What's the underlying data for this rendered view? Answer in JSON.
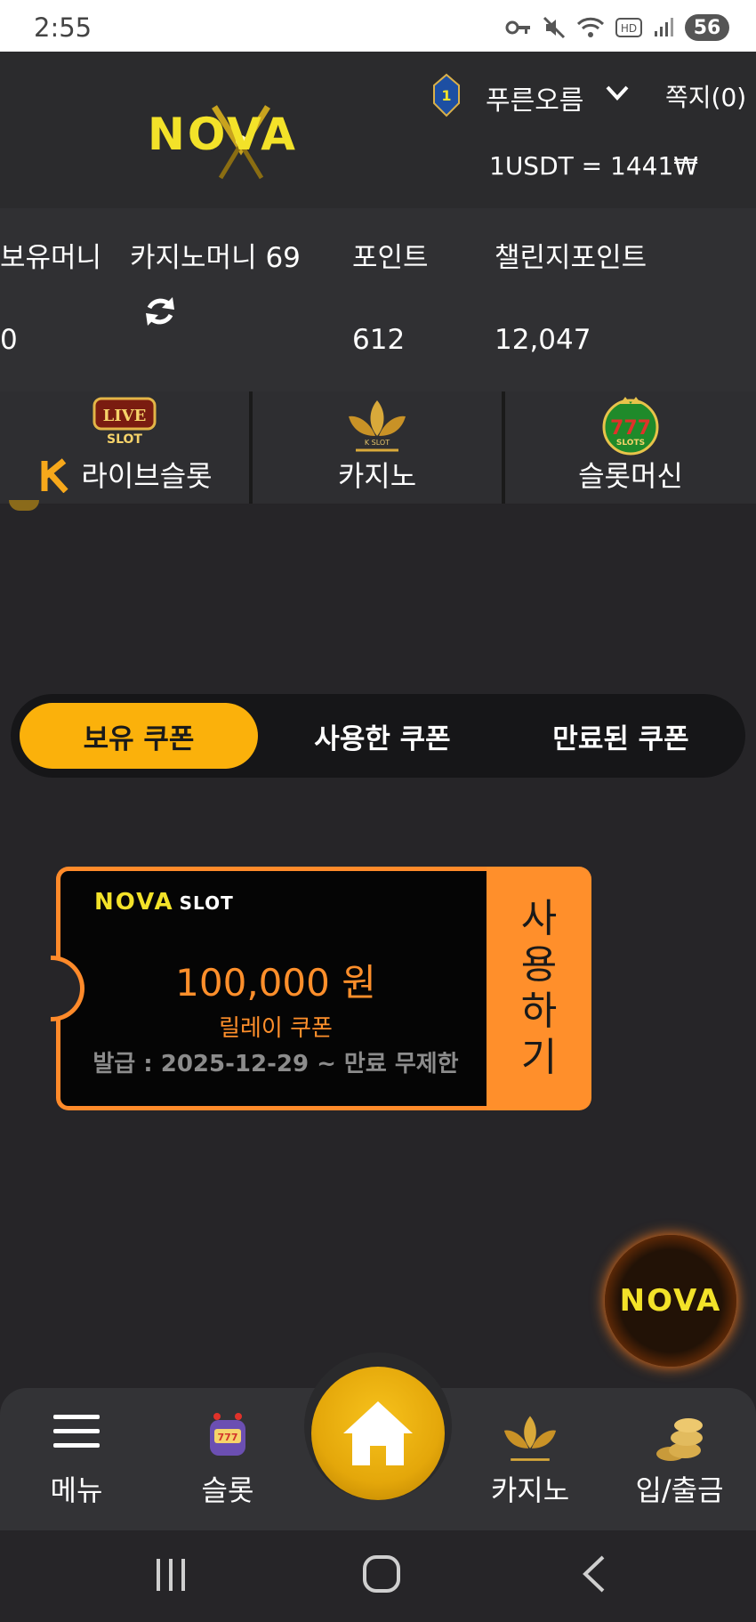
{
  "status_bar": {
    "time": "2:55",
    "battery": "56"
  },
  "header": {
    "logo": "NOVA",
    "rank_level": "1",
    "username": "푸른오름",
    "memo": "쪽지(0)",
    "exchange_rate": "1USDT = 1441₩"
  },
  "balance": {
    "holding_money_label": "보유머니",
    "holding_money_value": "0",
    "casino_money_label": "카지노머니 69",
    "points_label": "포인트",
    "points_value": "612",
    "challenge_points_label": "챌린지포인트",
    "challenge_points_value": "12,047"
  },
  "categories": [
    {
      "label": "라이브슬롯",
      "icon": "live-slot-icon"
    },
    {
      "label": "카지노",
      "icon": "k-slot-lotus-icon"
    },
    {
      "label": "슬롯머신",
      "icon": "777-slots-icon"
    }
  ],
  "coupon_tabs": [
    {
      "label": "보유 쿠폰",
      "active": true
    },
    {
      "label": "사용한 쿠폰",
      "active": false
    },
    {
      "label": "만료된 쿠폰",
      "active": false
    }
  ],
  "coupon": {
    "brand": "NOVA",
    "brand_suffix": "SLOT",
    "amount": "100,000 원",
    "type": "릴레이 쿠폰",
    "issued": "발급 : 2025-12-29 ~ 만료 무제한",
    "use_label": "사용하기"
  },
  "fab": {
    "label": "NOVA"
  },
  "bottom_nav": [
    {
      "label": "메뉴",
      "icon": "hamburger-menu-icon"
    },
    {
      "label": "슬롯",
      "icon": "slot-machine-icon"
    },
    {
      "label": "",
      "icon": "home-icon"
    },
    {
      "label": "카지노",
      "icon": "k-slot-lotus-icon"
    },
    {
      "label": "입/출금",
      "icon": "gold-coins-icon"
    }
  ],
  "colors": {
    "accent": "#fbb10b",
    "coupon_orange": "#ff8f2b",
    "background": "#262528",
    "logo_yellow": "#f3e229"
  }
}
